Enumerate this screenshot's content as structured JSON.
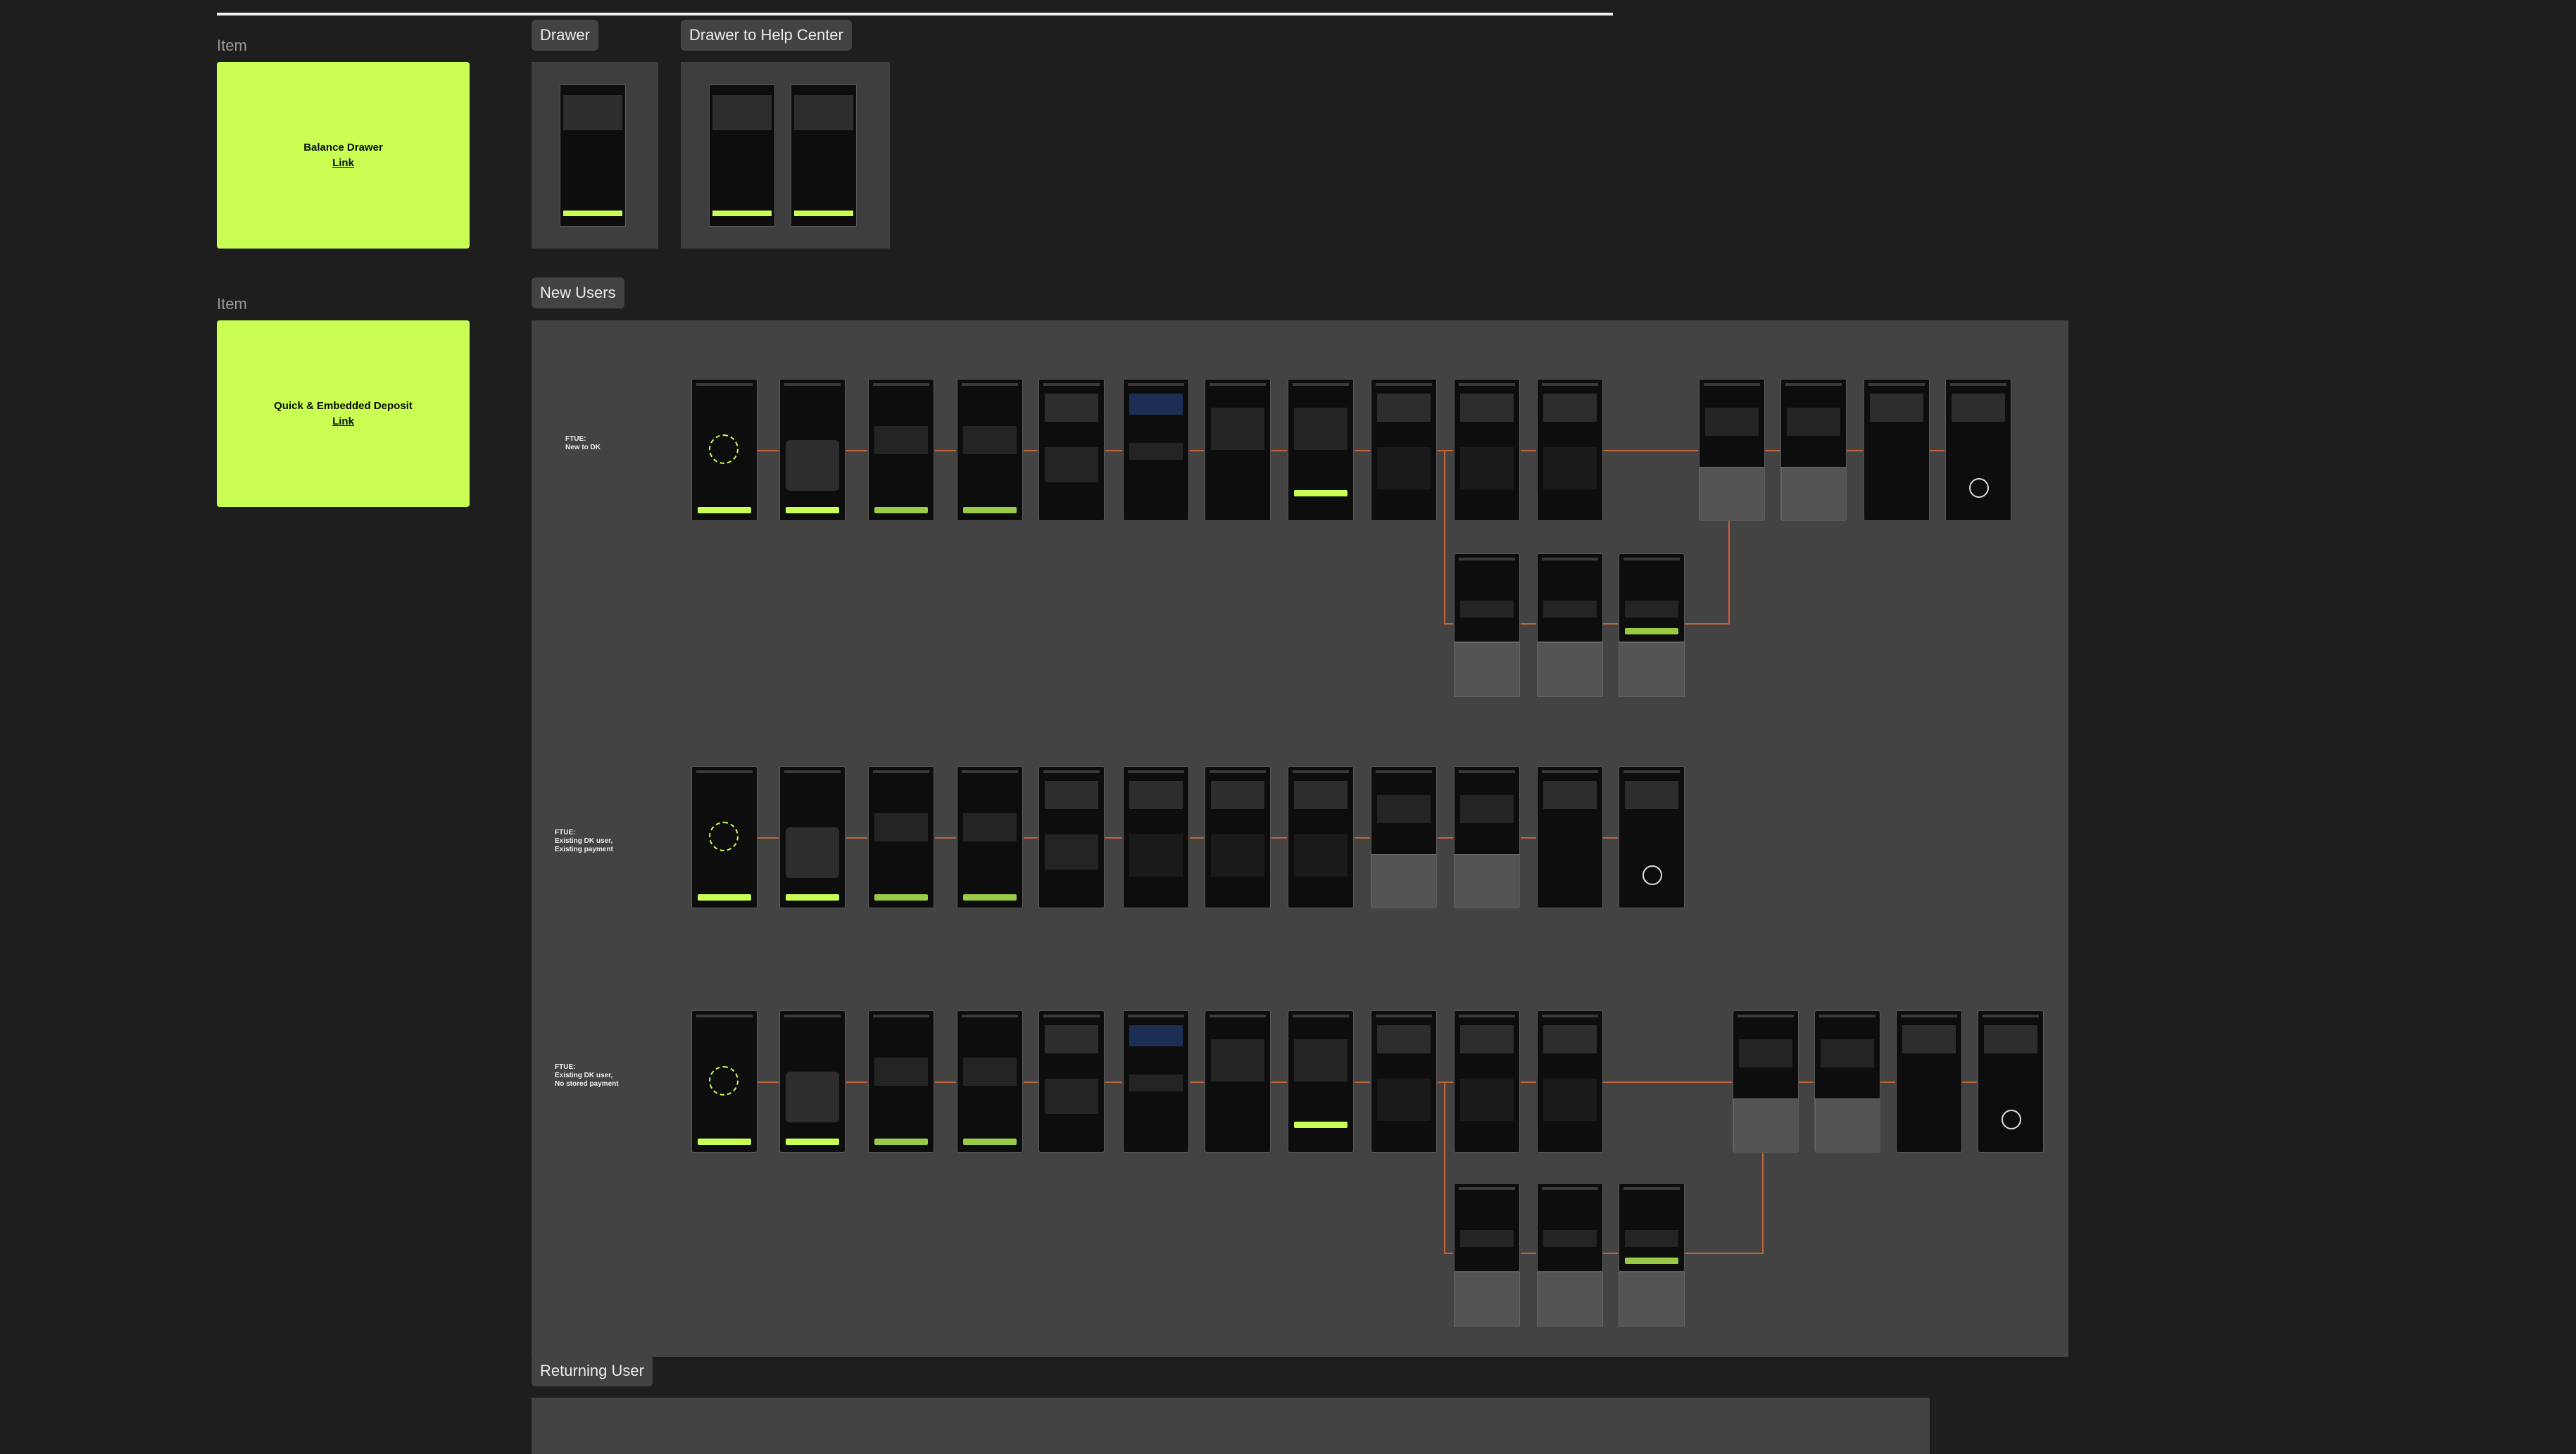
{
  "top_items": [
    {
      "label": "Item",
      "title": "Balance Drawer",
      "link": "Link"
    },
    {
      "label": "Item",
      "title": "Quick & Embedded Deposit",
      "link": "Link"
    }
  ],
  "sections": {
    "drawer": "Drawer",
    "drawer_help": "Drawer to Help Center",
    "new_users": "New Users",
    "returning": "Returning User"
  },
  "flow_rows": [
    {
      "label_line1": "FTUE:",
      "label_line2": "New to DK",
      "label_line3": ""
    },
    {
      "label_line1": "FTUE:",
      "label_line2": "Existing DK user,",
      "label_line3": "Existing payment"
    },
    {
      "label_line1": "FTUE:",
      "label_line2": "Existing DK user,",
      "label_line3": "No stored payment"
    }
  ],
  "colors": {
    "accent": "#c8ff52",
    "canvas": "#1e1e1e",
    "panel": "#434343",
    "connector": "#c2643a"
  }
}
